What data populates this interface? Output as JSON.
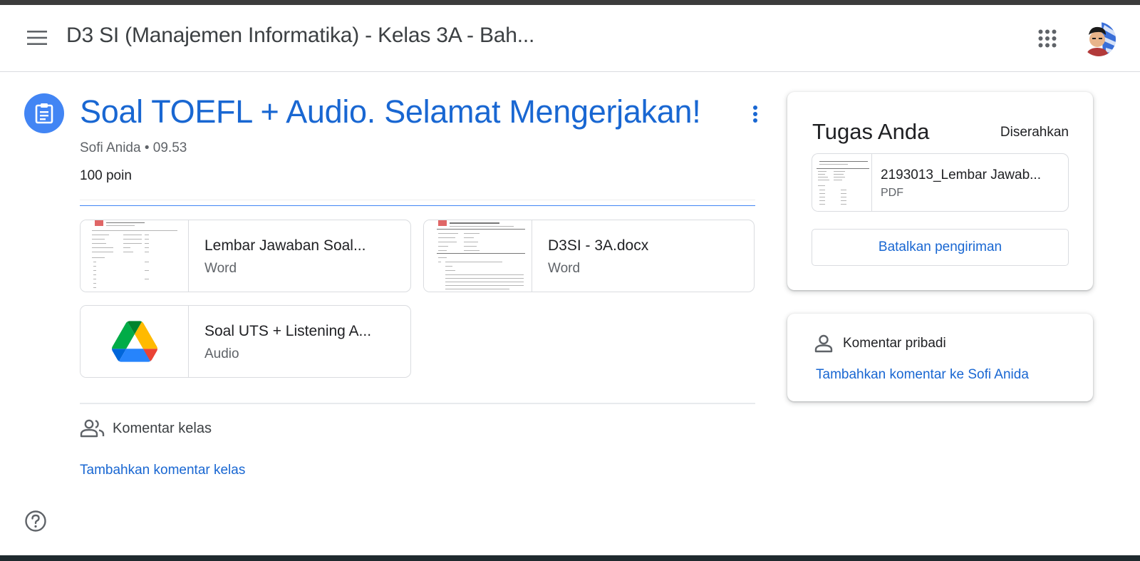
{
  "header": {
    "title": "D3 SI (Manajemen Informatika) - Kelas 3A - Bah..."
  },
  "assignment": {
    "title": "Soal TOEFL + Audio. Selamat Mengerjakan!",
    "author": "Sofi Anida",
    "separator": "•",
    "time": "09.53",
    "points": "100 poin"
  },
  "attachments": [
    {
      "name": "Lembar Jawaban Soal...",
      "type": "Word",
      "icon": "word-doc-thumbnail"
    },
    {
      "name": "D3SI - 3A.docx",
      "type": "Word",
      "icon": "word-doc-thumbnail"
    },
    {
      "name": "Soal UTS + Listening A...",
      "type": "Audio",
      "icon": "google-drive-icon"
    }
  ],
  "class_comments": {
    "label": "Komentar kelas",
    "add_link": "Tambahkan komentar kelas"
  },
  "your_work": {
    "title": "Tugas Anda",
    "status": "Diserahkan",
    "file_name": "2193013_Lembar Jawab...",
    "file_type": "PDF",
    "unsubmit_label": "Batalkan pengiriman"
  },
  "private_comments": {
    "label": "Komentar pribadi",
    "add_link": "Tambahkan komentar ke Sofi Anida"
  },
  "colors": {
    "accent_blue": "#1967d2",
    "icon_blue": "#4285f4",
    "header_strip": "#3c3c3c"
  }
}
